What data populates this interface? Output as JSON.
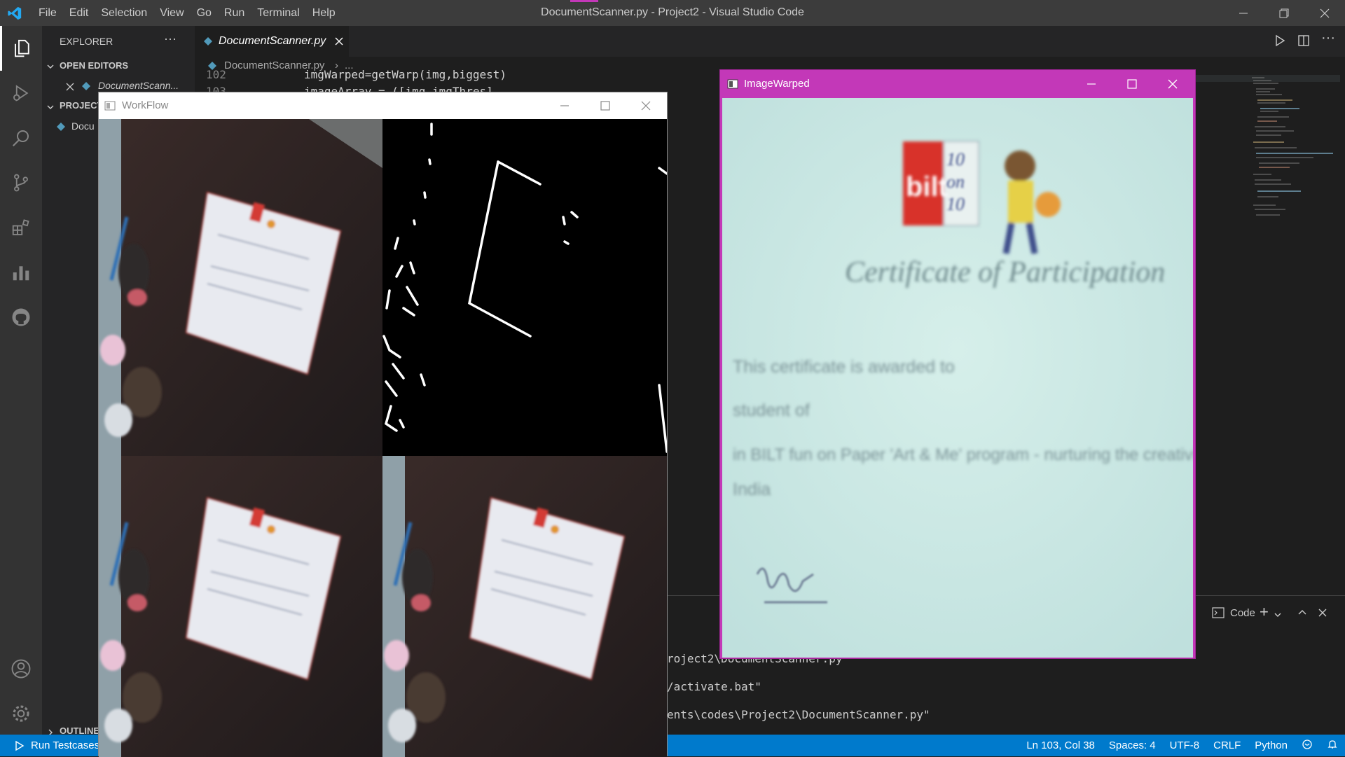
{
  "window": {
    "title": "DocumentScanner.py - Project2 - Visual Studio Code",
    "menu": [
      "File",
      "Edit",
      "Selection",
      "View",
      "Go",
      "Run",
      "Terminal",
      "Help"
    ]
  },
  "sidebar": {
    "header": "EXPLORER",
    "open_editors_label": "OPEN EDITORS",
    "open_editor_file": "DocumentScann...",
    "project_label": "PROJECT",
    "project_file": "Docu",
    "outline_label": "OUTLINE"
  },
  "editor": {
    "tab_label": "DocumentScanner.py",
    "breadcrumb_file": "DocumentScanner.py",
    "breadcrumb_more": "...",
    "line_numbers": [
      "102",
      "103"
    ],
    "code_lines": [
      "imgWarped=getWarp(img,biggest)",
      "imageArray = ([img,imgThres]"
    ]
  },
  "panel": {
    "terminal_selector": "Code",
    "lines": [
      "roject2\\DocumentScanner.py",
      "/activate.bat\"",
      "ents\\codes\\Project2\\DocumentScanner.py\""
    ]
  },
  "statusbar": {
    "left_label": "Run Testcases",
    "position": "Ln 103, Col 38",
    "spaces": "Spaces: 4",
    "encoding": "UTF-8",
    "eol": "CRLF",
    "language": "Python"
  },
  "workflow_window": {
    "title": "WorkFlow"
  },
  "warped_window": {
    "title": "ImageWarped",
    "certificate": {
      "heading": "Certificate of Participation",
      "line1": "This certificate is awarded to",
      "line2": "student of",
      "line3": "in BILT fun on Paper 'Art & Me' program - nurturing the creativity of young",
      "line4": "India",
      "logo_text": "bilt",
      "logo_tag": "10 on 10"
    }
  },
  "colors": {
    "accent": "#007acc",
    "warped_title": "#c338b8"
  }
}
